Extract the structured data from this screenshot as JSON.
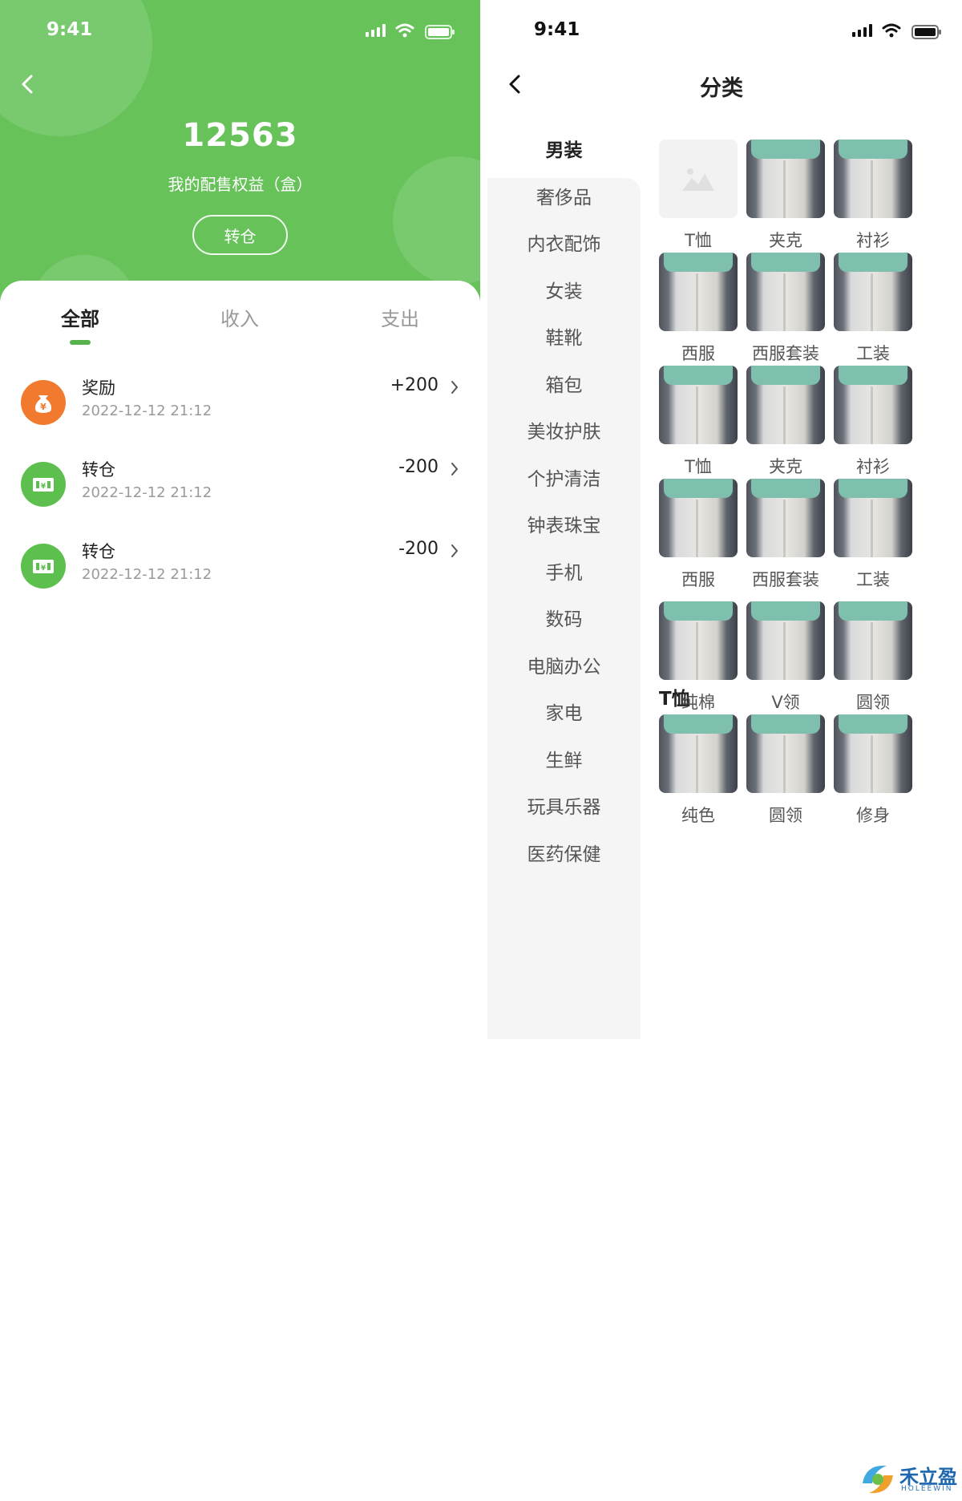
{
  "left": {
    "status_time": "9:41",
    "amount": "12563",
    "subtitle": "我的配售权益（盒）",
    "transfer_button": "转仓",
    "tabs": [
      {
        "label": "全部",
        "active": true
      },
      {
        "label": "收入",
        "active": false
      },
      {
        "label": "支出",
        "active": false
      }
    ],
    "records": [
      {
        "title": "奖励",
        "time": "2022-12-12 21:12",
        "amount": "+200",
        "icon": "money-bag-icon",
        "color": "#f27a2e"
      },
      {
        "title": "转仓",
        "time": "2022-12-12 21:12",
        "amount": "-200",
        "icon": "transfer-ticket-icon",
        "color": "#5cbf4e"
      },
      {
        "title": "转仓",
        "time": "2022-12-12 21:12",
        "amount": "-200",
        "icon": "transfer-ticket-icon",
        "color": "#5cbf4e"
      }
    ]
  },
  "right": {
    "status_time": "9:41",
    "title": "分类",
    "categories": [
      {
        "label": "男装",
        "active": true
      },
      {
        "label": "奢侈品"
      },
      {
        "label": "内衣配饰"
      },
      {
        "label": "女装"
      },
      {
        "label": "鞋靴"
      },
      {
        "label": "箱包"
      },
      {
        "label": "美妆护肤"
      },
      {
        "label": "个护清洁"
      },
      {
        "label": "钟表珠宝"
      },
      {
        "label": "手机"
      },
      {
        "label": "数码"
      },
      {
        "label": "电脑办公"
      },
      {
        "label": "家电"
      },
      {
        "label": "生鲜"
      },
      {
        "label": "玩具乐器"
      },
      {
        "label": "医药保健"
      }
    ],
    "group1": [
      "T恤",
      "夹克",
      "衬衫",
      "西服",
      "西服套装",
      "工装",
      "T恤",
      "夹克",
      "衬衫",
      "西服",
      "西服套装",
      "工装"
    ],
    "section2_title": "T恤",
    "group2": [
      "纯棉",
      "V领",
      "圆领",
      "纯色",
      "圆领",
      "修身"
    ]
  },
  "watermark": {
    "name": "禾立盈",
    "sub": "HOLEEWIN"
  },
  "colors": {
    "brand_green": "#67c25a",
    "accent_orange": "#f27a2e"
  }
}
